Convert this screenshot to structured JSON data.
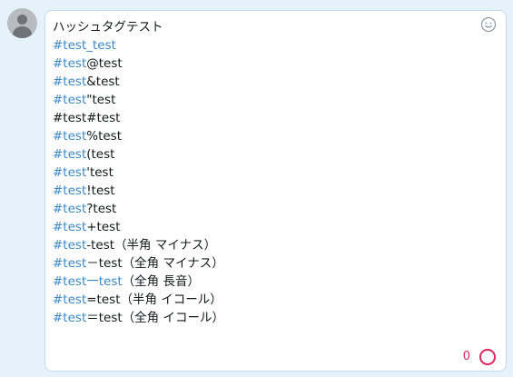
{
  "composer": {
    "lines": [
      {
        "segments": [
          {
            "text": "ハッシュタグテスト",
            "tag": false
          }
        ]
      },
      {
        "segments": [
          {
            "text": "#test_test",
            "tag": true
          }
        ]
      },
      {
        "segments": [
          {
            "text": "#test",
            "tag": true
          },
          {
            "text": "@test",
            "tag": false
          }
        ]
      },
      {
        "segments": [
          {
            "text": "#test",
            "tag": true
          },
          {
            "text": "&test",
            "tag": false
          }
        ]
      },
      {
        "segments": [
          {
            "text": "#test",
            "tag": true
          },
          {
            "text": "\"test",
            "tag": false
          }
        ]
      },
      {
        "segments": [
          {
            "text": "#test#test",
            "tag": false
          }
        ]
      },
      {
        "segments": [
          {
            "text": "#test",
            "tag": true
          },
          {
            "text": "%test",
            "tag": false
          }
        ]
      },
      {
        "segments": [
          {
            "text": "#test",
            "tag": true
          },
          {
            "text": "(test",
            "tag": false
          }
        ]
      },
      {
        "segments": [
          {
            "text": "#test",
            "tag": true
          },
          {
            "text": "'test",
            "tag": false
          }
        ]
      },
      {
        "segments": [
          {
            "text": "#test",
            "tag": true
          },
          {
            "text": "!test",
            "tag": false
          }
        ]
      },
      {
        "segments": [
          {
            "text": "#test",
            "tag": true
          },
          {
            "text": "?test",
            "tag": false
          }
        ]
      },
      {
        "segments": [
          {
            "text": "#test",
            "tag": true
          },
          {
            "text": "+test",
            "tag": false
          }
        ]
      },
      {
        "segments": [
          {
            "text": "#test",
            "tag": true
          },
          {
            "text": "-test（半角 マイナス）",
            "tag": false
          }
        ]
      },
      {
        "segments": [
          {
            "text": "#test",
            "tag": true
          },
          {
            "text": "－test（全角 マイナス）",
            "tag": false
          }
        ]
      },
      {
        "segments": [
          {
            "text": "#test一test",
            "tag": true
          },
          {
            "text": "（全角 長音）",
            "tag": false
          }
        ]
      },
      {
        "segments": [
          {
            "text": "#test",
            "tag": true
          },
          {
            "text": "=test（半角 イコール）",
            "tag": false
          }
        ]
      },
      {
        "segments": [
          {
            "text": "#test",
            "tag": true
          },
          {
            "text": "＝test（全角 イコール）",
            "tag": false
          }
        ]
      }
    ],
    "counter": "0",
    "emoji_icon": "smiley-icon",
    "avatar_icon": "default-avatar-icon",
    "progress_icon": "character-count-ring-icon",
    "colors": {
      "hashtag": "#3b88c3",
      "text": "#14171a",
      "counter": "#e0245e",
      "border": "#bfdaf0",
      "background": "#e6f2fa"
    }
  }
}
